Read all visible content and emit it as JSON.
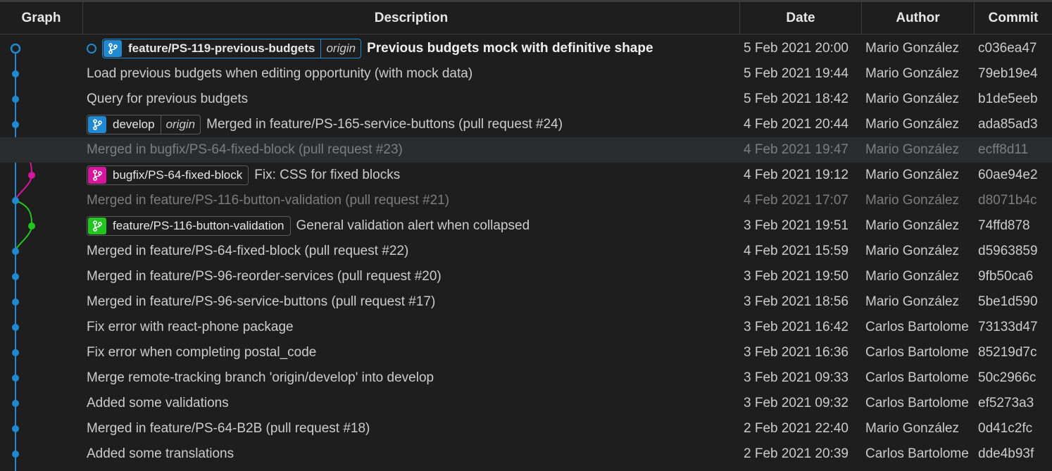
{
  "header": {
    "graph": "Graph",
    "description": "Description",
    "date": "Date",
    "author": "Author",
    "commit": "Commit"
  },
  "colors": {
    "main": "#1f8ad2",
    "bugfix": "#d6179d",
    "feature": "#22c520"
  },
  "commits": [
    {
      "message": "Previous budgets mock with definitive shape",
      "date": "5 Feb 2021 20:00",
      "author": "Mario González",
      "hash": "c036ea47",
      "branch": "feature/PS-119-previous-budgets",
      "origin": "origin"
    },
    {
      "message": "Load previous budgets when editing opportunity (with mock data)",
      "date": "5 Feb 2021 19:44",
      "author": "Mario González",
      "hash": "79eb19e4"
    },
    {
      "message": "Query for previous budgets",
      "date": "5 Feb 2021 18:42",
      "author": "Mario González",
      "hash": "b1de5eeb"
    },
    {
      "message": "Merged in feature/PS-165-service-buttons (pull request #24)",
      "date": "4 Feb 2021 20:44",
      "author": "Mario González",
      "hash": "ada85ad3",
      "branch": "develop",
      "origin": "origin"
    },
    {
      "message": "Merged in bugfix/PS-64-fixed-block (pull request #23)",
      "date": "4 Feb 2021 19:47",
      "author": "Mario González",
      "hash": "ecff8d11"
    },
    {
      "message": "Fix: CSS for fixed blocks",
      "date": "4 Feb 2021 19:12",
      "author": "Mario González",
      "hash": "60ae94e2",
      "branch": "bugfix/PS-64-fixed-block"
    },
    {
      "message": "Merged in feature/PS-116-button-validation (pull request #21)",
      "date": "4 Feb 2021 17:07",
      "author": "Mario González",
      "hash": "d8071b4c"
    },
    {
      "message": "General validation alert when collapsed",
      "date": "3 Feb 2021 19:51",
      "author": "Mario González",
      "hash": "74ffd878",
      "branch": "feature/PS-116-button-validation"
    },
    {
      "message": "Merged in feature/PS-64-fixed-block (pull request #22)",
      "date": "4 Feb 2021 15:59",
      "author": "Mario González",
      "hash": "d5963859"
    },
    {
      "message": "Merged in feature/PS-96-reorder-services (pull request #20)",
      "date": "3 Feb 2021 19:50",
      "author": "Mario González",
      "hash": "9fb50ca6"
    },
    {
      "message": "Merged in feature/PS-96-service-buttons (pull request #17)",
      "date": "3 Feb 2021 18:56",
      "author": "Mario González",
      "hash": "5be1d590"
    },
    {
      "message": "Fix error with react-phone package",
      "date": "3 Feb 2021 16:42",
      "author": "Carlos Bartolome",
      "hash": "73133d47"
    },
    {
      "message": "Fix error when completing postal_code",
      "date": "3 Feb 2021 16:36",
      "author": "Carlos Bartolome",
      "hash": "85219d7c"
    },
    {
      "message": "Merge remote-tracking branch 'origin/develop' into develop",
      "date": "3 Feb 2021 09:33",
      "author": "Carlos Bartolome",
      "hash": "50c2966c"
    },
    {
      "message": "Added some validations",
      "date": "3 Feb 2021 09:32",
      "author": "Carlos Bartolome",
      "hash": "ef5273a3"
    },
    {
      "message": "Merged in feature/PS-64-B2B (pull request #18)",
      "date": "2 Feb 2021 22:40",
      "author": "Mario González",
      "hash": "0d41c2fc"
    },
    {
      "message": "Added some translations",
      "date": "2 Feb 2021 20:39",
      "author": "Carlos Bartolome",
      "hash": "dde4b93f"
    }
  ]
}
